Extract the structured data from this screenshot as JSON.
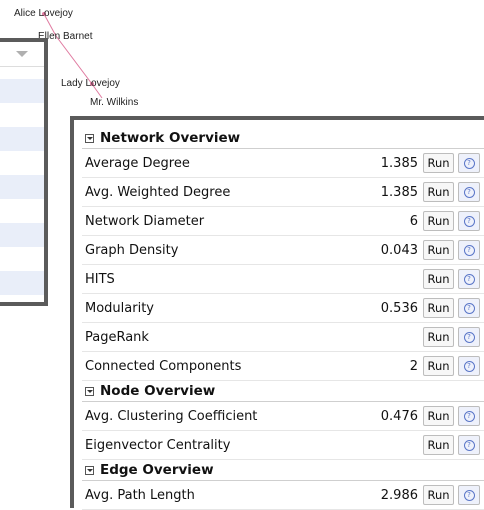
{
  "graph": {
    "nodes": [
      {
        "label": "Alice Lovejoy"
      },
      {
        "label": "Ellen Barnet"
      },
      {
        "label": "Lady Lovejoy"
      },
      {
        "label": "Mr. Wilkins"
      }
    ],
    "edge_color": "#e07aa0"
  },
  "statistics": {
    "sections": [
      {
        "title": "Network Overview",
        "rows": [
          {
            "label": "Average Degree",
            "value": "1.385",
            "run": "Run"
          },
          {
            "label": "Avg. Weighted Degree",
            "value": "1.385",
            "run": "Run"
          },
          {
            "label": "Network Diameter",
            "value": "6",
            "run": "Run"
          },
          {
            "label": "Graph Density",
            "value": "0.043",
            "run": "Run"
          },
          {
            "label": "HITS",
            "value": "",
            "run": "Run"
          },
          {
            "label": "Modularity",
            "value": "0.536",
            "run": "Run"
          },
          {
            "label": "PageRank",
            "value": "",
            "run": "Run"
          },
          {
            "label": "Connected Components",
            "value": "2",
            "run": "Run"
          }
        ]
      },
      {
        "title": "Node Overview",
        "rows": [
          {
            "label": "Avg. Clustering Coefficient",
            "value": "0.476",
            "run": "Run"
          },
          {
            "label": "Eigenvector Centrality",
            "value": "",
            "run": "Run"
          }
        ]
      },
      {
        "title": "Edge Overview",
        "rows": [
          {
            "label": "Avg. Path Length",
            "value": "2.986",
            "run": "Run"
          }
        ]
      }
    ],
    "help_icon": "help-circle-icon"
  },
  "colors": {
    "panel_border": "#5b5b5b",
    "row_alt": "#e9eef9",
    "help_bg": "#eef1fb",
    "help_fg": "#5a76c8"
  }
}
